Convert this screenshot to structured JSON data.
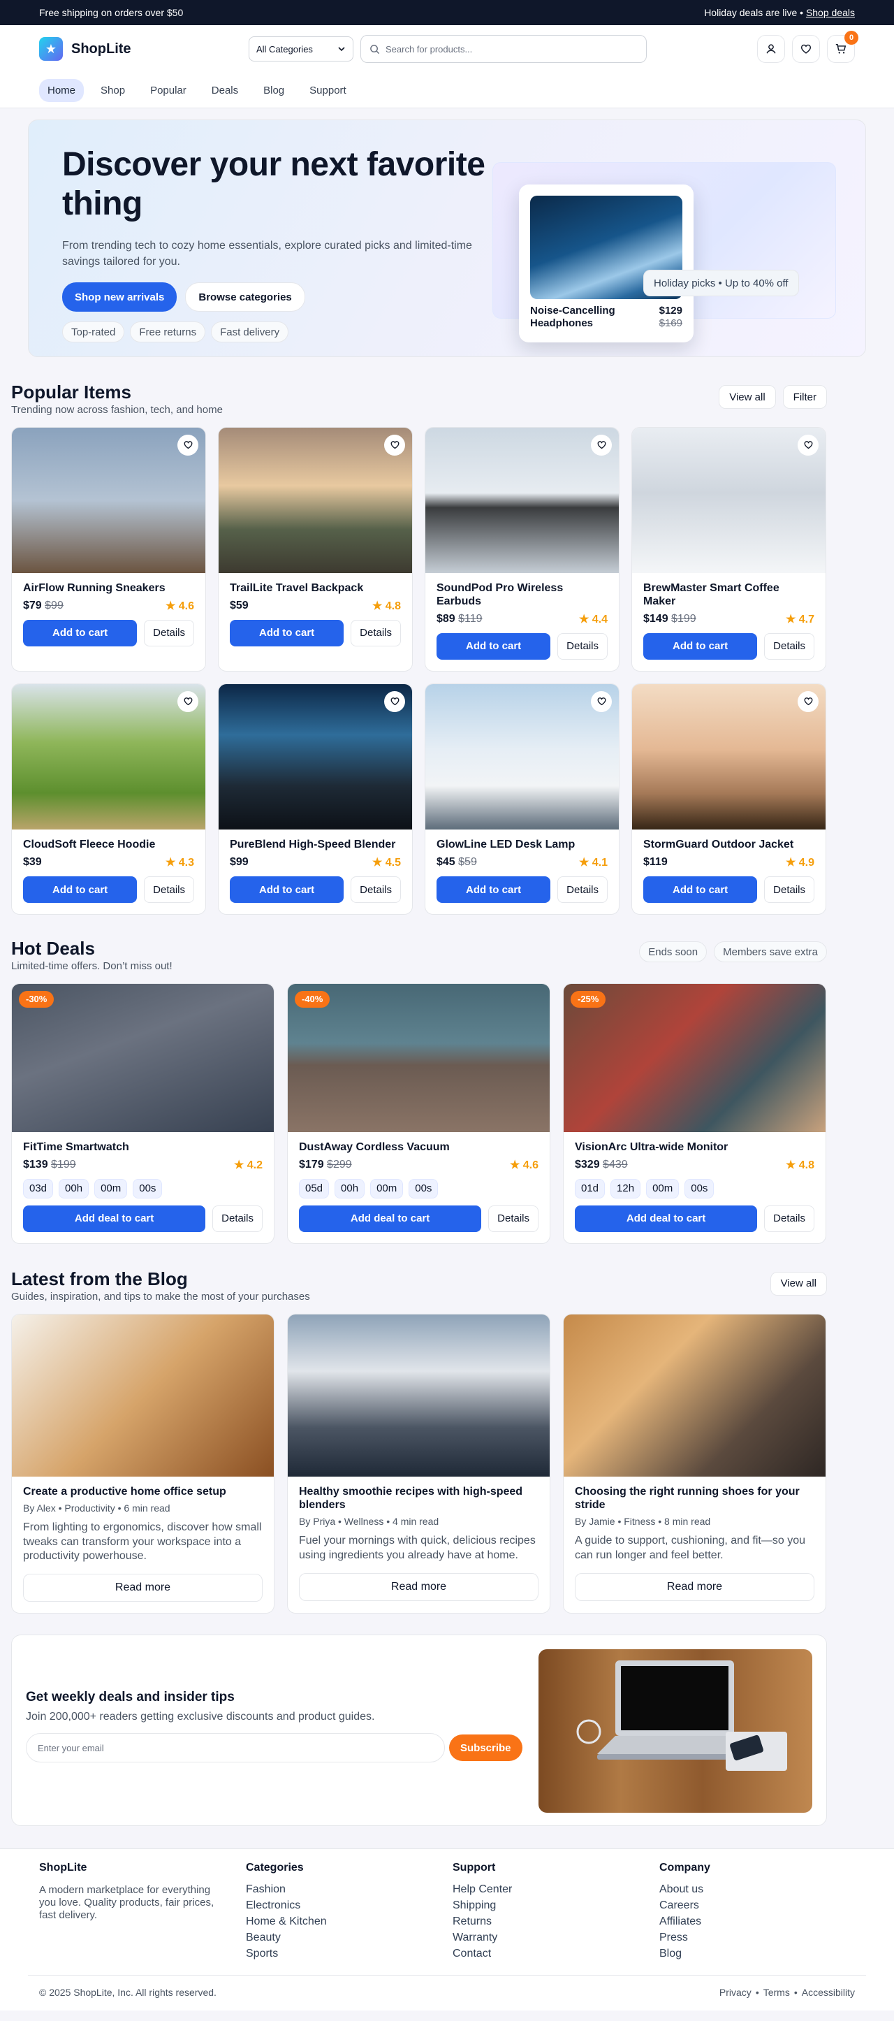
{
  "topbar": {
    "left": "Free shipping on orders over $50",
    "right_text": "Holiday deals are live • ",
    "right_link": "Shop deals"
  },
  "header": {
    "brand": "ShopLite",
    "category_select": "All Categories",
    "search_placeholder": "Search for products...",
    "cart_count": "0"
  },
  "nav": [
    {
      "label": "Home",
      "active": true
    },
    {
      "label": "Shop"
    },
    {
      "label": "Popular"
    },
    {
      "label": "Deals"
    },
    {
      "label": "Blog"
    },
    {
      "label": "Support"
    }
  ],
  "hero": {
    "title": "Discover your next favorite thing",
    "subtitle": "From trending tech to cozy home essentials, explore curated picks and limited-time savings tailored for you.",
    "primary_cta": "Shop new arrivals",
    "secondary_cta": "Browse categories",
    "chips": [
      "Top-rated",
      "Free returns",
      "Fast delivery"
    ],
    "card": {
      "name": "Noise-Cancelling Headphones",
      "price": "$129",
      "old_price": "$169"
    },
    "pill": "Holiday picks • Up to 40% off"
  },
  "popular": {
    "title": "Popular Items",
    "subtitle": "Trending now across fashion, tech, and home",
    "view_all": "View all",
    "filter": "Filter",
    "add_label": "Add to cart",
    "details_label": "Details",
    "items": [
      {
        "name": "AirFlow Running Sneakers",
        "price": "$79",
        "old_price": "$99",
        "rating": "4.6"
      },
      {
        "name": "TrailLite Travel Backpack",
        "price": "$59",
        "old_price": "",
        "rating": "4.8"
      },
      {
        "name": "SoundPod Pro Wireless Earbuds",
        "price": "$89",
        "old_price": "$119",
        "rating": "4.4"
      },
      {
        "name": "BrewMaster Smart Coffee Maker",
        "price": "$149",
        "old_price": "$199",
        "rating": "4.7"
      },
      {
        "name": "CloudSoft Fleece Hoodie",
        "price": "$39",
        "old_price": "",
        "rating": "4.3"
      },
      {
        "name": "PureBlend High-Speed Blender",
        "price": "$99",
        "old_price": "",
        "rating": "4.5"
      },
      {
        "name": "GlowLine LED Desk Lamp",
        "price": "$45",
        "old_price": "$59",
        "rating": "4.1"
      },
      {
        "name": "StormGuard Outdoor Jacket",
        "price": "$119",
        "old_price": "",
        "rating": "4.9"
      }
    ]
  },
  "deals": {
    "title": "Hot Deals",
    "subtitle": "Limited-time offers. Don’t miss out!",
    "tag1": "Ends soon",
    "tag2": "Members save extra",
    "add_label": "Add deal to cart",
    "details_label": "Details",
    "items": [
      {
        "badge": "-30%",
        "name": "FitTime Smartwatch",
        "price": "$139",
        "old_price": "$199",
        "rating": "4.2",
        "timer": [
          "03d",
          "00h",
          "00m",
          "00s"
        ]
      },
      {
        "badge": "-40%",
        "name": "DustAway Cordless Vacuum",
        "price": "$179",
        "old_price": "$299",
        "rating": "4.6",
        "timer": [
          "05d",
          "00h",
          "00m",
          "00s"
        ]
      },
      {
        "badge": "-25%",
        "name": "VisionArc Ultra-wide Monitor",
        "price": "$329",
        "old_price": "$439",
        "rating": "4.8",
        "timer": [
          "01d",
          "12h",
          "00m",
          "00s"
        ]
      }
    ]
  },
  "blog": {
    "title": "Latest from the Blog",
    "subtitle": "Guides, inspiration, and tips to make the most of your purchases",
    "view_all": "View all",
    "read_more": "Read more",
    "posts": [
      {
        "title": "Create a productive home office setup",
        "meta": "By Alex • Productivity • 6 min read",
        "excerpt": "From lighting to ergonomics, discover how small tweaks can transform your workspace into a productivity powerhouse."
      },
      {
        "title": "Healthy smoothie recipes with high-speed blenders",
        "meta": "By Priya • Wellness • 4 min read",
        "excerpt": "Fuel your mornings with quick, delicious recipes using ingredients you already have at home."
      },
      {
        "title": "Choosing the right running shoes for your stride",
        "meta": "By Jamie • Fitness • 8 min read",
        "excerpt": "A guide to support, cushioning, and fit—so you can run longer and feel better."
      }
    ]
  },
  "newsletter": {
    "title": "Get weekly deals and insider tips",
    "subtitle": "Join 200,000+ readers getting exclusive discounts and product guides.",
    "placeholder": "Enter your email",
    "button": "Subscribe"
  },
  "footer": {
    "brand": "ShopLite",
    "description": "A modern marketplace for everything you love. Quality products, fair prices, fast delivery.",
    "columns": [
      {
        "title": "Categories",
        "links": [
          "Fashion",
          "Electronics",
          "Home & Kitchen",
          "Beauty",
          "Sports"
        ]
      },
      {
        "title": "Support",
        "links": [
          "Help Center",
          "Shipping",
          "Returns",
          "Warranty",
          "Contact"
        ]
      },
      {
        "title": "Company",
        "links": [
          "About us",
          "Careers",
          "Affiliates",
          "Press",
          "Blog"
        ]
      }
    ],
    "copyright": "© 2025 ShopLite, Inc. All rights reserved.",
    "legal": [
      "Privacy",
      "Terms",
      "Accessibility"
    ]
  }
}
